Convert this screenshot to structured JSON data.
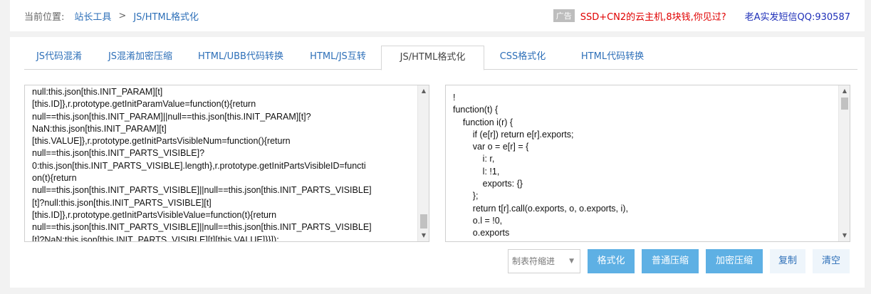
{
  "breadcrumb": {
    "label": "当前位置:",
    "home": "站长工具",
    "separator": ">",
    "current": "JS/HTML格式化"
  },
  "ad": {
    "badge": "广告",
    "text": "SSD+CN2的云主机,8块钱,你见过?",
    "qq": "老A实发短信QQ:930587"
  },
  "tabs": [
    {
      "label": "JS代码混淆"
    },
    {
      "label": "JS混淆加密压缩"
    },
    {
      "label": "HTML/UBB代码转换"
    },
    {
      "label": "HTML/JS互转"
    },
    {
      "label": "JS/HTML格式化",
      "active": true
    },
    {
      "label": "CSS格式化"
    },
    {
      "label": "HTML代码转换"
    }
  ],
  "input_editor": {
    "lines": [
      "null:this.json[this.INIT_PARAM][t]",
      "[this.ID]},r.prototype.getInitParamValue=function(t){return",
      "null==this.json[this.INIT_PARAM]||null==this.json[this.INIT_PARAM][t]?",
      "NaN:this.json[this.INIT_PARAM][t]",
      "[this.VALUE]},r.prototype.getInitPartsVisibleNum=function(){return",
      "null==this.json[this.INIT_PARTS_VISIBLE]?",
      "0:this.json[this.INIT_PARTS_VISIBLE].length},r.prototype.getInitPartsVisibleID=functi",
      "on(t){return",
      "null==this.json[this.INIT_PARTS_VISIBLE]||null==this.json[this.INIT_PARTS_VISIBLE]",
      "[t]?null:this.json[this.INIT_PARTS_VISIBLE][t]",
      "[this.ID]},r.prototype.getInitPartsVisibleValue=function(t){return",
      "null==this.json[this.INIT_PARTS_VISIBLE]||null==this.json[this.INIT_PARTS_VISIBLE]",
      "[t]?NaN:this.json[this.INIT_PARTS_VISIBLE][t][this.VALUE]}}]);"
    ]
  },
  "output_editor": {
    "lines": [
      "!",
      "function(t) {",
      "    function i(r) {",
      "        if (e[r]) return e[r].exports;",
      "        var o = e[r] = {",
      "            i: r,",
      "            l: !1,",
      "            exports: {}",
      "        };",
      "        return t[r].call(o.exports, o, o.exports, i),",
      "        o.l = !0,",
      "        o.exports",
      "    }"
    ]
  },
  "toolbar": {
    "indent_select": "制表符缩进",
    "format_label": "格式化",
    "compress_label": "普通压缩",
    "encrypt_label": "加密压缩",
    "copy_label": "复制",
    "clear_label": "清空"
  },
  "colors": {
    "link": "#2d6fb8",
    "primary_button": "#5eb0e4",
    "ad_red": "#e00000",
    "qq_blue": "#1e2fb8"
  }
}
